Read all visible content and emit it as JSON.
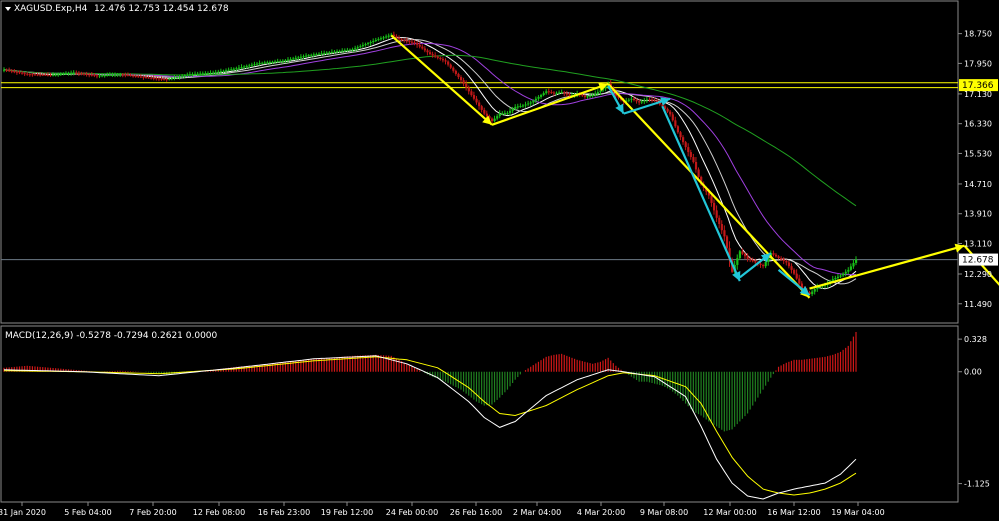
{
  "header": {
    "symbol_text": "XAGUSD.Exp,H4",
    "ohlc_text": "12.476 12.753 12.454 12.678"
  },
  "macd_header": {
    "text": "MACD(12,26,9) -0.5278 -0.7294 0.2621 0.0000"
  },
  "colors": {
    "background": "#000000",
    "bull": "#18c018",
    "bear": "#c01818",
    "hline": "#ffff00",
    "arrow_yellow": "#ffff00",
    "arrow_cyan": "#22c6d8",
    "ma_violet": "#a040e0",
    "ma_green": "#20a020",
    "macd_pos": "#d01818",
    "macd_neg": "#208020"
  },
  "chart_data": [
    {
      "type": "candlestick",
      "symbol": "XAGUSD.Exp",
      "timeframe": "H4",
      "ohlc_current": {
        "open": 12.476,
        "high": 12.753,
        "low": 12.454,
        "close": 12.678
      },
      "ylim": [
        11.0,
        19.6
      ],
      "y_ticks": [
        "18.750",
        "17.950",
        "17.130",
        "16.330",
        "15.530",
        "14.710",
        "13.910",
        "13.110",
        "12.290",
        "11.490"
      ],
      "price_tags": [
        "17.366",
        "12.678"
      ],
      "x_ticks": [
        "31 Jan 2020",
        "5 Feb 04:00",
        "7 Feb 20:00",
        "12 Feb 08:00",
        "16 Feb 23:00",
        "19 Feb 12:00",
        "24 Feb 00:00",
        "26 Feb 16:00",
        "2 Mar 04:00",
        "4 Mar 20:00",
        "9 Mar 08:00",
        "12 Mar 00:00",
        "16 Mar 12:00",
        "19 Mar 04:00"
      ],
      "horizontal_lines": [
        17.43,
        17.3,
        12.678
      ],
      "close_path": [
        [
          0,
          17.78
        ],
        [
          3,
          17.66
        ],
        [
          6,
          17.64
        ],
        [
          9,
          17.7
        ],
        [
          12,
          17.62
        ],
        [
          15,
          17.66
        ],
        [
          18,
          17.58
        ],
        [
          21,
          17.52
        ],
        [
          24,
          17.66
        ],
        [
          27,
          17.7
        ],
        [
          30,
          17.82
        ],
        [
          33,
          17.96
        ],
        [
          36,
          18.02
        ],
        [
          39,
          18.16
        ],
        [
          42,
          18.25
        ],
        [
          45,
          18.33
        ],
        [
          48,
          18.58
        ],
        [
          50,
          18.72
        ],
        [
          51,
          18.6
        ],
        [
          53,
          18.5
        ],
        [
          55,
          18.2
        ],
        [
          57,
          18.0
        ],
        [
          59,
          17.5
        ],
        [
          60,
          17.2
        ],
        [
          61,
          16.9
        ],
        [
          62,
          16.6
        ],
        [
          63,
          16.4
        ],
        [
          64,
          16.6
        ],
        [
          65,
          16.62
        ],
        [
          66,
          16.78
        ],
        [
          67,
          16.82
        ],
        [
          68,
          16.9
        ],
        [
          69,
          17.05
        ],
        [
          70,
          17.2
        ],
        [
          71,
          17.15
        ],
        [
          72,
          17.18
        ],
        [
          73,
          17.08
        ],
        [
          74,
          17.14
        ],
        [
          75,
          17.05
        ],
        [
          76,
          17.1
        ],
        [
          77,
          17.22
        ],
        [
          78,
          17.4
        ],
        [
          79,
          17.08
        ],
        [
          80,
          16.92
        ],
        [
          81,
          17.0
        ],
        [
          82,
          16.9
        ],
        [
          83,
          16.98
        ],
        [
          84,
          16.95
        ],
        [
          85,
          16.8
        ],
        [
          86,
          16.58
        ],
        [
          87,
          16.1
        ],
        [
          88,
          15.7
        ],
        [
          89,
          15.3
        ],
        [
          90,
          14.7
        ],
        [
          91,
          14.4
        ],
        [
          92,
          13.8
        ],
        [
          93,
          13.3
        ],
        [
          94,
          12.35
        ],
        [
          95,
          12.9
        ],
        [
          96,
          12.7
        ],
        [
          97,
          12.6
        ],
        [
          98,
          12.5
        ],
        [
          99,
          12.85
        ],
        [
          100,
          12.72
        ],
        [
          101,
          12.6
        ],
        [
          102,
          12.3
        ],
        [
          103,
          11.9
        ],
        [
          104,
          11.75
        ],
        [
          105,
          11.95
        ],
        [
          106,
          12.0
        ],
        [
          107,
          12.15
        ],
        [
          108,
          12.25
        ],
        [
          109,
          12.4
        ],
        [
          110,
          12.68
        ]
      ]
    },
    {
      "type": "macd",
      "params": "12,26,9",
      "main": -0.5278,
      "signal": -0.7294,
      "values": [
        0.2621,
        0.0
      ],
      "ylim": [
        -1.3,
        0.45
      ],
      "y_ticks": [
        "0.328",
        "0.00",
        "-1.125"
      ],
      "histogram": [
        [
          0,
          0.04
        ],
        [
          3,
          0.06
        ],
        [
          6,
          0.04
        ],
        [
          9,
          0.02
        ],
        [
          12,
          0.0
        ],
        [
          15,
          0.01
        ],
        [
          18,
          0.0
        ],
        [
          21,
          -0.03
        ],
        [
          24,
          0.0
        ],
        [
          27,
          0.02
        ],
        [
          30,
          0.05
        ],
        [
          33,
          0.07
        ],
        [
          36,
          0.09
        ],
        [
          39,
          0.12
        ],
        [
          42,
          0.14
        ],
        [
          45,
          0.16
        ],
        [
          48,
          0.17
        ],
        [
          50,
          0.16
        ],
        [
          51,
          0.12
        ],
        [
          53,
          0.04
        ],
        [
          55,
          -0.04
        ],
        [
          57,
          -0.1
        ],
        [
          59,
          -0.18
        ],
        [
          60,
          -0.24
        ],
        [
          61,
          -0.3
        ],
        [
          62,
          -0.34
        ],
        [
          63,
          -0.33
        ],
        [
          64,
          -0.26
        ],
        [
          65,
          -0.18
        ],
        [
          66,
          -0.08
        ],
        [
          67,
          0.0
        ],
        [
          68,
          0.05
        ],
        [
          69,
          0.1
        ],
        [
          70,
          0.15
        ],
        [
          71,
          0.17
        ],
        [
          72,
          0.18
        ],
        [
          73,
          0.15
        ],
        [
          74,
          0.12
        ],
        [
          75,
          0.1
        ],
        [
          76,
          0.08
        ],
        [
          77,
          0.1
        ],
        [
          78,
          0.14
        ],
        [
          79,
          0.06
        ],
        [
          80,
          0.0
        ],
        [
          81,
          -0.05
        ],
        [
          82,
          -0.1
        ],
        [
          83,
          -0.1
        ],
        [
          84,
          -0.12
        ],
        [
          85,
          -0.14
        ],
        [
          86,
          -0.18
        ],
        [
          87,
          -0.24
        ],
        [
          88,
          -0.32
        ],
        [
          89,
          -0.4
        ],
        [
          90,
          -0.44
        ],
        [
          91,
          -0.5
        ],
        [
          92,
          -0.55
        ],
        [
          93,
          -0.6
        ],
        [
          94,
          -0.58
        ],
        [
          95,
          -0.5
        ],
        [
          96,
          -0.42
        ],
        [
          97,
          -0.3
        ],
        [
          98,
          -0.18
        ],
        [
          99,
          -0.06
        ],
        [
          100,
          0.05
        ],
        [
          101,
          0.09
        ],
        [
          102,
          0.12
        ],
        [
          103,
          0.12
        ],
        [
          104,
          0.13
        ],
        [
          105,
          0.14
        ],
        [
          106,
          0.15
        ],
        [
          107,
          0.17
        ],
        [
          108,
          0.2
        ],
        [
          109,
          0.26
        ],
        [
          110,
          0.4
        ]
      ],
      "main_path": [
        [
          0,
          0.02
        ],
        [
          10,
          0.0
        ],
        [
          20,
          -0.04
        ],
        [
          30,
          0.04
        ],
        [
          40,
          0.13
        ],
        [
          48,
          0.16
        ],
        [
          52,
          0.08
        ],
        [
          56,
          -0.06
        ],
        [
          60,
          -0.3
        ],
        [
          62,
          -0.46
        ],
        [
          64,
          -0.56
        ],
        [
          66,
          -0.5
        ],
        [
          70,
          -0.24
        ],
        [
          74,
          -0.08
        ],
        [
          78,
          0.02
        ],
        [
          80,
          0.0
        ],
        [
          84,
          -0.05
        ],
        [
          88,
          -0.25
        ],
        [
          90,
          -0.55
        ],
        [
          92,
          -0.88
        ],
        [
          94,
          -1.12
        ],
        [
          96,
          -1.25
        ],
        [
          98,
          -1.28
        ],
        [
          100,
          -1.22
        ],
        [
          102,
          -1.18
        ],
        [
          104,
          -1.15
        ],
        [
          106,
          -1.12
        ],
        [
          108,
          -1.03
        ],
        [
          110,
          -0.88
        ]
      ],
      "signal_path": [
        [
          0,
          0.01
        ],
        [
          10,
          0.0
        ],
        [
          20,
          -0.02
        ],
        [
          30,
          0.03
        ],
        [
          40,
          0.11
        ],
        [
          48,
          0.15
        ],
        [
          52,
          0.12
        ],
        [
          56,
          0.04
        ],
        [
          60,
          -0.16
        ],
        [
          62,
          -0.3
        ],
        [
          64,
          -0.42
        ],
        [
          66,
          -0.44
        ],
        [
          70,
          -0.34
        ],
        [
          74,
          -0.18
        ],
        [
          78,
          -0.04
        ],
        [
          80,
          -0.01
        ],
        [
          84,
          -0.04
        ],
        [
          88,
          -0.15
        ],
        [
          90,
          -0.32
        ],
        [
          92,
          -0.6
        ],
        [
          94,
          -0.86
        ],
        [
          96,
          -1.05
        ],
        [
          98,
          -1.18
        ],
        [
          100,
          -1.22
        ],
        [
          102,
          -1.24
        ],
        [
          104,
          -1.22
        ],
        [
          106,
          -1.18
        ],
        [
          108,
          -1.12
        ],
        [
          110,
          -1.02
        ]
      ]
    }
  ]
}
